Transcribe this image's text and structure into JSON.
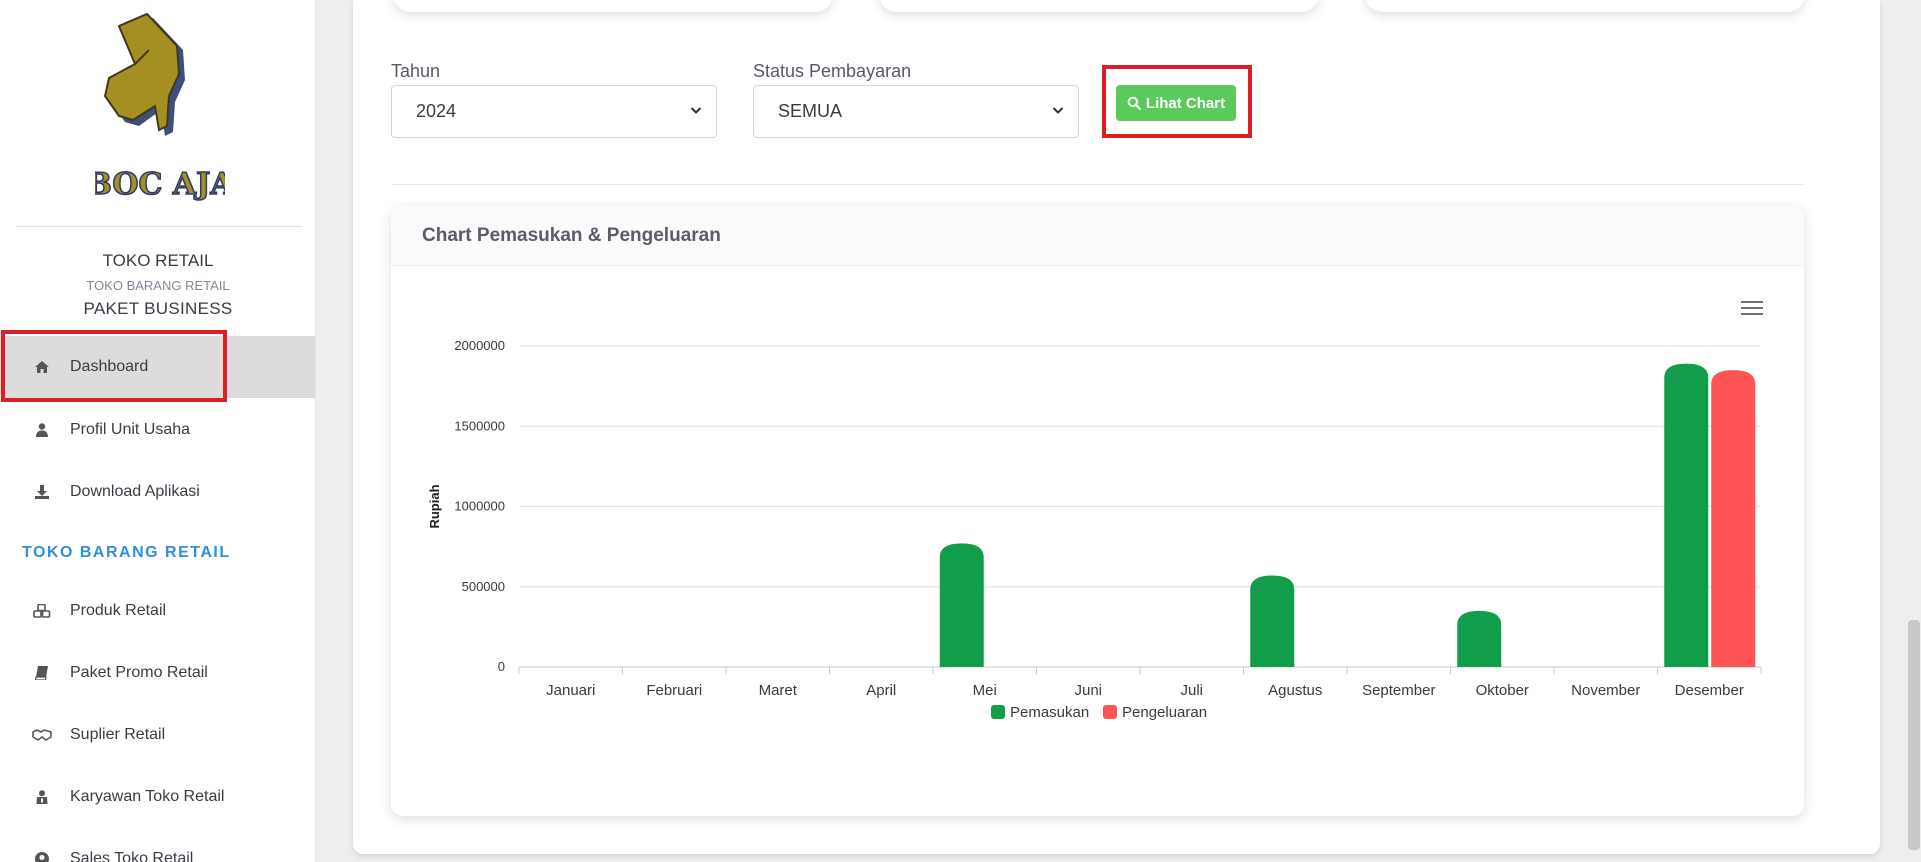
{
  "sidebar": {
    "logo_text": "BOC AJA",
    "store_title": "TOKO RETAIL",
    "store_subtitle": "TOKO BARANG RETAIL",
    "package": "PAKET BUSINESS",
    "nav_top": [
      {
        "label": "Dashboard",
        "icon": "home-icon",
        "active": true
      },
      {
        "label": "Profil Unit Usaha",
        "icon": "user-icon"
      },
      {
        "label": "Download Aplikasi",
        "icon": "download-icon"
      }
    ],
    "section_heading": "TOKO BARANG RETAIL",
    "nav_section": [
      {
        "label": "Produk Retail",
        "icon": "cubes-icon"
      },
      {
        "label": "Paket Promo Retail",
        "icon": "book-icon"
      },
      {
        "label": "Suplier Retail",
        "icon": "handshake-icon"
      },
      {
        "label": "Karyawan Toko Retail",
        "icon": "user-tie-icon"
      },
      {
        "label": "Sales Toko Retail",
        "icon": "user-circle-icon"
      }
    ]
  },
  "filters": {
    "year_label": "Tahun",
    "year_value": "2024",
    "status_label": "Status Pembayaran",
    "status_value": "SEMUA",
    "button_label": "Lihat Chart"
  },
  "chart_card": {
    "title": "Chart Pemasukan & Pengeluaran"
  },
  "colors": {
    "pemasukan": "#129d4b",
    "pengeluaran": "#fe5455",
    "button": "#5acb5b",
    "highlight": "#dc1f26",
    "heading_blue": "#2e8ee0"
  },
  "chart_data": {
    "type": "bar",
    "title": "",
    "xlabel": "",
    "ylabel": "Rupiah",
    "ylim": [
      0,
      2000000
    ],
    "yticks": [
      "0",
      "500000",
      "1000000",
      "1500000",
      "2000000"
    ],
    "categories": [
      "Januari",
      "Februari",
      "Maret",
      "April",
      "Mei",
      "Juni",
      "Juli",
      "Agustus",
      "September",
      "Oktober",
      "November",
      "Desember"
    ],
    "series": [
      {
        "name": "Pemasukan",
        "values": [
          0,
          0,
          0,
          0,
          770000,
          0,
          0,
          570000,
          0,
          350000,
          0,
          1890000
        ]
      },
      {
        "name": "Pengeluaran",
        "values": [
          0,
          0,
          0,
          0,
          0,
          0,
          0,
          0,
          0,
          0,
          0,
          1850000
        ]
      }
    ],
    "legend_position": "bottom",
    "grid": true
  }
}
